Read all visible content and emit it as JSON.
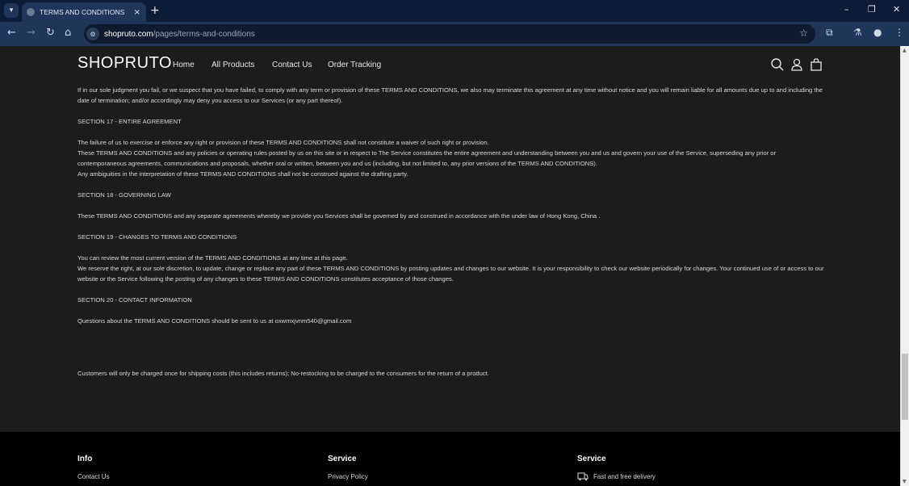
{
  "browser": {
    "tab_title": "TERMS AND CONDITIONS",
    "url_domain": "shopruto.com",
    "url_path": "/pages/terms-and-conditions",
    "icons": {
      "tab_search": "chevron-down",
      "tab_favicon": "globe",
      "tab_close": "×",
      "new_tab": "+",
      "minimize": "–",
      "restore": "❐",
      "close": "✕",
      "back": "←",
      "forward": "→",
      "reload": "↻",
      "home": "⌂",
      "site_info": "⚙",
      "bookmark": "☆",
      "extensions": "⧉",
      "labs": "⚗",
      "profile": "●",
      "menu": "⋮"
    }
  },
  "header": {
    "logo": "SHOPRUTO",
    "nav": [
      "Home",
      "All Products",
      "Contact Us",
      "Order Tracking"
    ]
  },
  "content": {
    "section16_tail": [
      "If in our sole judgment you fail, or we suspect that you have failed, to comply with any term or provision of these TERMS AND CONDITIONS, we also may terminate this agreement at any time without notice and you will remain liable for all amounts due up to and including the date of termination; and/or accordingly may deny you access to our Services (or any part thereof)."
    ],
    "section17_title": "SECTION 17 - ENTIRE AGREEMENT",
    "section17_body": [
      "The failure of us to exercise or enforce any right or provision of these TERMS AND CONDITIONS shall not constitute a waiver of such right or provision.",
      "These TERMS AND CONDITIONS and any policies or operating rules posted by us on this site or in respect to The Service constitutes the entire agreement and understanding between you and us and govern your use of the Service, superseding any prior or contemporaneous agreements, communications and proposals, whether oral or written, between you and us (including, but not limited to, any prior versions of the TERMS AND CONDITIONS).",
      "Any ambiguities in the interpretation of these TERMS AND CONDITIONS shall not be construed against the drafting party."
    ],
    "section18_title": "SECTION 18 - GOVERNING LAW",
    "section18_body": "These TERMS AND CONDITIONS and any separate agreements whereby we provide you Services shall be governed by and construed in accordance with the under law of Hong Kong, China .",
    "section19_title": "SECTION 19 - CHANGES TO TERMS AND CONDITIONS",
    "section19_body": [
      "You can review the most current version of the TERMS AND CONDITIONS at any time at this page.",
      "We reserve the right, at our sole discretion, to update, change or replace any part of these TERMS AND CONDITIONS by posting updates and changes to our website. It is your responsibility to check our website periodically for changes. Your continued use of or access to our website or the Service following the posting of any changes to these TERMS AND CONDITIONS constitutes acceptance of those changes."
    ],
    "section20_title": "SECTION 20 - CONTACT INFORMATION",
    "section20_body": "Questions about the TERMS AND CONDITIONS should be sent to us at oxwmxjvnm540@gmail.com",
    "shipping_note": "Customers will only be charged once for shipping costs (this includes returns); No-restocking to be charged to the consumers for the return of a product."
  },
  "footer": {
    "col1": {
      "title": "Info",
      "links": [
        "Contact Us"
      ]
    },
    "col2": {
      "title": "Service",
      "links": [
        "Privacy Policy"
      ]
    },
    "col3": {
      "title": "Service",
      "items": [
        "Fast and free delivery"
      ]
    }
  }
}
